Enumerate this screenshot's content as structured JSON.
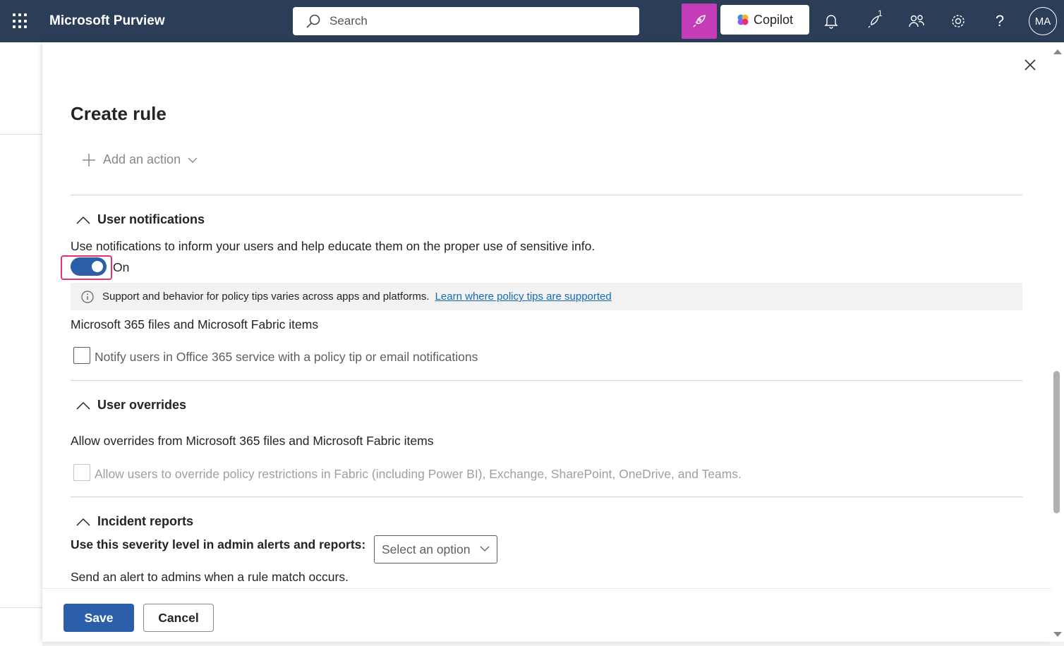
{
  "header": {
    "app_title": "Microsoft Purview",
    "search_placeholder": "Search",
    "copilot_label": "Copilot",
    "notification_badge": "1",
    "avatar_initials": "MA",
    "rocket_bg": "#c43cb8",
    "bar_bg": "#2b3d57"
  },
  "panel": {
    "title": "Create rule",
    "add_action_label": "Add an action"
  },
  "user_notifications": {
    "heading": "User notifications",
    "description": "Use notifications to inform your users and help educate them on the proper use of sensitive info.",
    "toggle_state": "On",
    "toggle_on": true,
    "info_text": "Support and behavior for policy tips varies across apps and platforms.",
    "info_link": "Learn where policy tips are supported",
    "files_heading": "Microsoft 365 files and Microsoft Fabric items",
    "notify_checkbox_label": "Notify users in Office 365 service with a policy tip or email notifications",
    "notify_checked": false
  },
  "user_overrides": {
    "heading": "User overrides",
    "description": "Allow overrides from Microsoft 365 files and Microsoft Fabric items",
    "override_checkbox_label": "Allow users to override policy restrictions in Fabric (including Power BI), Exchange, SharePoint, OneDrive, and Teams.",
    "override_checked": false,
    "override_disabled": true
  },
  "incident_reports": {
    "heading": "Incident reports",
    "severity_label": "Use this severity level in admin alerts and reports:",
    "severity_select": "Select an option",
    "alert_text": "Send an alert to admins when a rule match occurs."
  },
  "footer": {
    "save_label": "Save",
    "cancel_label": "Cancel",
    "primary_color": "#2b5faa"
  },
  "accents": {
    "toggle_highlight": "#e8306e",
    "link_color": "#0f6cbd"
  }
}
